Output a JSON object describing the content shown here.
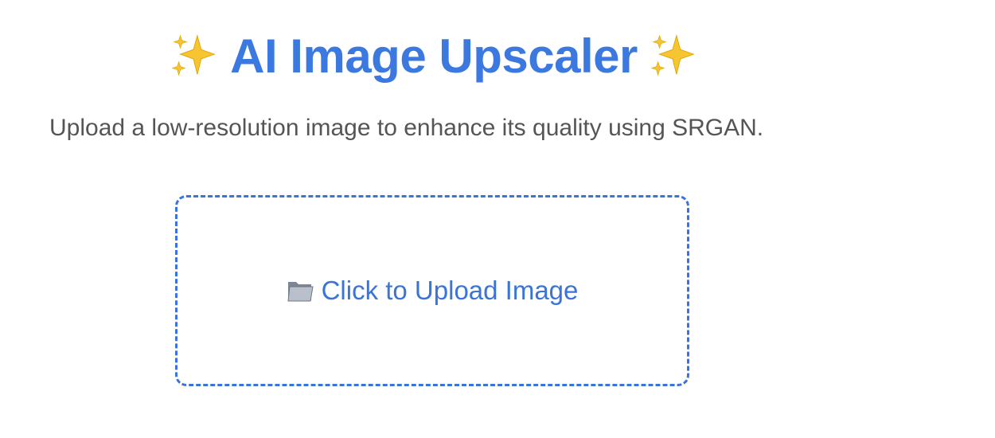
{
  "header": {
    "title": "AI Image Upscaler",
    "leading_icon": "sparkles-icon",
    "trailing_icon": "sparkles-icon"
  },
  "description": "Upload a low-resolution image to enhance its quality using SRGAN.",
  "uploader": {
    "icon": "folder-icon",
    "label": "Click to Upload Image"
  },
  "colors": {
    "accent": "#3b78e0",
    "text_muted": "#555555",
    "sparkle": "#f5c518"
  }
}
